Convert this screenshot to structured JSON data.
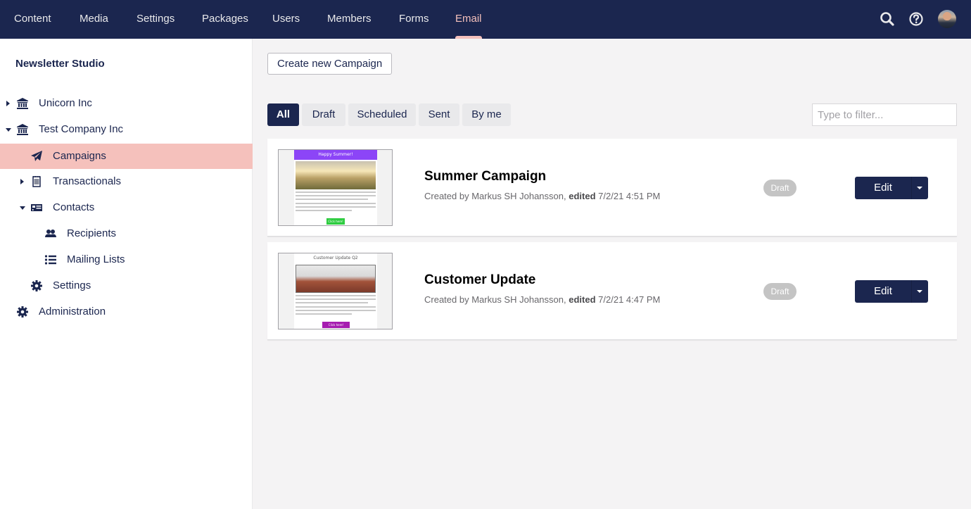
{
  "topnav": {
    "items": [
      {
        "label": "Content"
      },
      {
        "label": "Media"
      },
      {
        "label": "Settings"
      },
      {
        "label": "Packages"
      },
      {
        "label": "Users"
      },
      {
        "label": "Members"
      },
      {
        "label": "Forms"
      },
      {
        "label": "Email",
        "active": true
      }
    ],
    "actions": {
      "search_icon": "search-icon",
      "help_icon": "help-icon",
      "avatar": "user-avatar"
    }
  },
  "sidebar": {
    "title": "Newsletter Studio",
    "tree": [
      {
        "label": "Unicorn Inc",
        "icon": "institution-icon",
        "caret": "right"
      },
      {
        "label": "Test Company Inc",
        "icon": "institution-icon",
        "caret": "down"
      },
      {
        "label": "Campaigns",
        "icon": "paper-plane-icon",
        "active": true
      },
      {
        "label": "Transactionals",
        "icon": "notepad-icon",
        "caret": "right"
      },
      {
        "label": "Contacts",
        "icon": "id-card-icon",
        "caret": "down"
      },
      {
        "label": "Recipients",
        "icon": "users-icon"
      },
      {
        "label": "Mailing Lists",
        "icon": "list-icon"
      },
      {
        "label": "Settings",
        "icon": "gear-icon"
      },
      {
        "label": "Administration",
        "icon": "gear-icon"
      }
    ]
  },
  "main": {
    "create_button": "Create new Campaign",
    "filters": [
      {
        "label": "All",
        "active": true
      },
      {
        "label": "Draft"
      },
      {
        "label": "Scheduled"
      },
      {
        "label": "Sent"
      },
      {
        "label": "By me"
      }
    ],
    "filter_placeholder": "Type to filter...",
    "filter_value": "",
    "campaigns": [
      {
        "title": "Summer Campaign",
        "created_prefix": "Created by Markus SH Johansson,",
        "edited_label": "edited",
        "edited_time": "7/2/21 4:51 PM",
        "status": "Draft",
        "edit_label": "Edit",
        "thumbnail": {
          "header": "Happy Summer!",
          "header_bg": "#8c45f7",
          "header_color": "#ffffff",
          "button_label": "Click here!",
          "button_color": "#2ecc40"
        }
      },
      {
        "title": "Customer Update",
        "created_prefix": "Created by Markus SH Johansson,",
        "edited_label": "edited",
        "edited_time": "7/2/21 4:47 PM",
        "status": "Draft",
        "edit_label": "Edit",
        "thumbnail": {
          "header": "Customer Update Q2",
          "header_bg": "#ffffff",
          "header_color": "#555555",
          "button_label": "Click here!",
          "button_color": "#a61cb0"
        }
      }
    ]
  },
  "colors": {
    "brand": "#1b264f",
    "accent": "#f5c1bc",
    "background": "#f4f3f4",
    "badge": "#c4c4c4"
  }
}
